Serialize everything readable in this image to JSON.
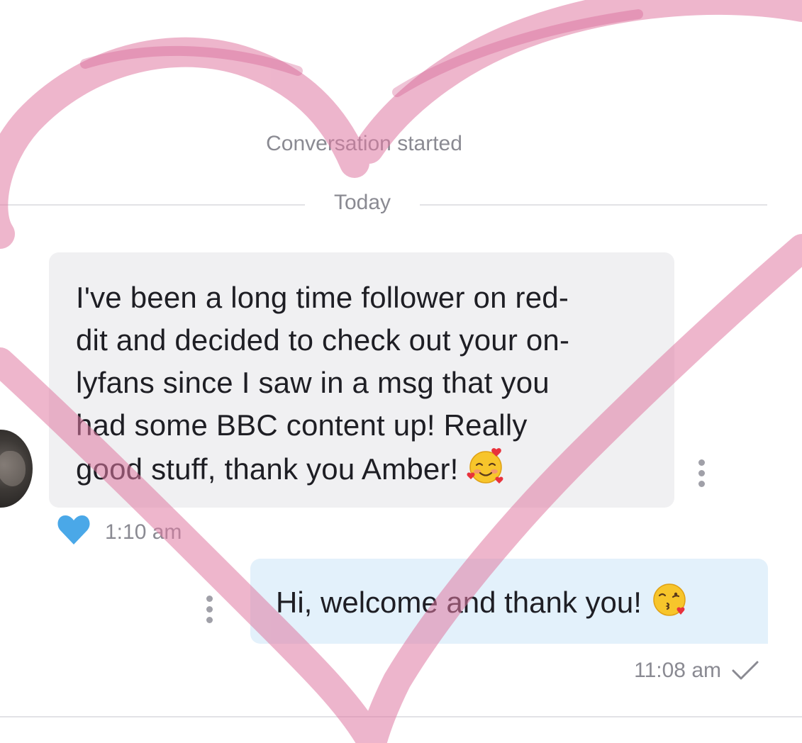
{
  "conversation": {
    "started_label": "Conversation started",
    "date_label": "Today"
  },
  "messages": [
    {
      "direction": "incoming",
      "text": "I've been a long time follower on red-dit and decided to check out your on-lyfans since I saw in a msg that you had some BBC content up! Really good stuff, thank you Amber!",
      "lines": [
        "I've been a long time follower on red-",
        "dit and decided to check out your on-",
        "lyfans since I saw in a msg that you",
        "had some BBC content up! Really",
        "good stuff, thank you Amber!"
      ],
      "emoji": "🥰",
      "time": "1:10 am",
      "liked": true
    },
    {
      "direction": "outgoing",
      "text": "Hi, welcome and thank you!",
      "emoji": "😘",
      "time": "11:08 am",
      "status": "sent"
    }
  ],
  "icons": {
    "like": "heart-icon",
    "more": "more-vertical-icon",
    "sent": "checkmark-icon"
  },
  "colors": {
    "like_heart": "#4aa8e8",
    "incoming_bubble": "#f0f0f2",
    "outgoing_bubble": "#e3f1fb",
    "doodle": "#e07aa3"
  }
}
